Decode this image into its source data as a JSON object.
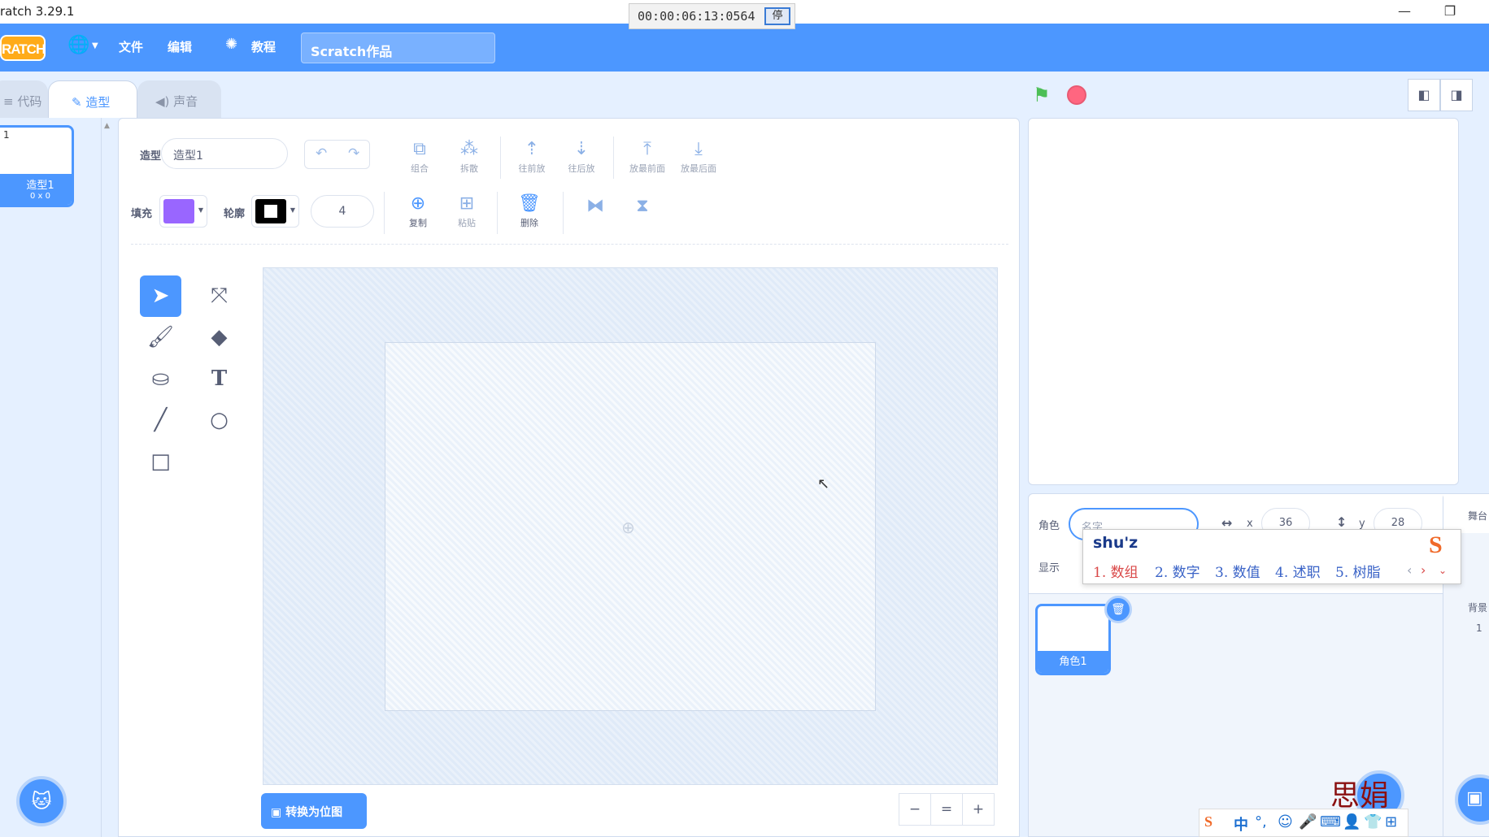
{
  "window": {
    "title": "ratch 3.29.1",
    "minimize": "—",
    "restore": "❐"
  },
  "timer": {
    "time": "00:00:06:13:0564",
    "stop_label": "停"
  },
  "menubar": {
    "logo": "RATCH",
    "file": "文件",
    "edit": "编辑",
    "tutorials": "教程",
    "project_title": "Scratch作品"
  },
  "tabs": {
    "code": "代码",
    "costumes": "造型",
    "sounds": "声音"
  },
  "costume_list": {
    "items": [
      {
        "number": "1",
        "name": "造型1",
        "size": "0 x 0"
      }
    ]
  },
  "paint_editor": {
    "costume_label": "造型",
    "costume_name": "造型1",
    "fill_label": "填充",
    "outline_label": "轮廓",
    "outline_width": "4",
    "fill_color": "#9966ff",
    "outline_color": "#000000",
    "buttons": {
      "group": "组合",
      "ungroup": "拆散",
      "forward": "往前放",
      "backward": "往后放",
      "front": "放最前面",
      "back": "放最后面",
      "copy": "复制",
      "paste": "粘贴",
      "delete": "删除"
    },
    "convert_to_bitmap": "转换为位图",
    "zoom": {
      "out": "−",
      "reset": "=",
      "in": "+"
    }
  },
  "sprite_info": {
    "sprite_label": "角色",
    "sprite_name_placeholder": "名字",
    "x_label": "x",
    "x_value": "36",
    "y_label": "y",
    "y_value": "28",
    "show_label": "显示"
  },
  "sprites": [
    {
      "name": "角色1"
    }
  ],
  "stage_pane": {
    "header": "舞台",
    "backdrops_label": "背景",
    "backdrops_count": "1"
  },
  "ime": {
    "input": "shu'z",
    "candidates": [
      "1. 数组",
      "2. 数字",
      "3. 数值",
      "4. 述职",
      "5. 树脂"
    ],
    "logo": "S"
  },
  "watermark": "思娟",
  "ime_bar": {
    "mode": "中",
    "punct": "°,"
  },
  "colors": {
    "accent": "#4c97ff",
    "menubar": "#4c97ff",
    "background": "#e5f0ff"
  }
}
